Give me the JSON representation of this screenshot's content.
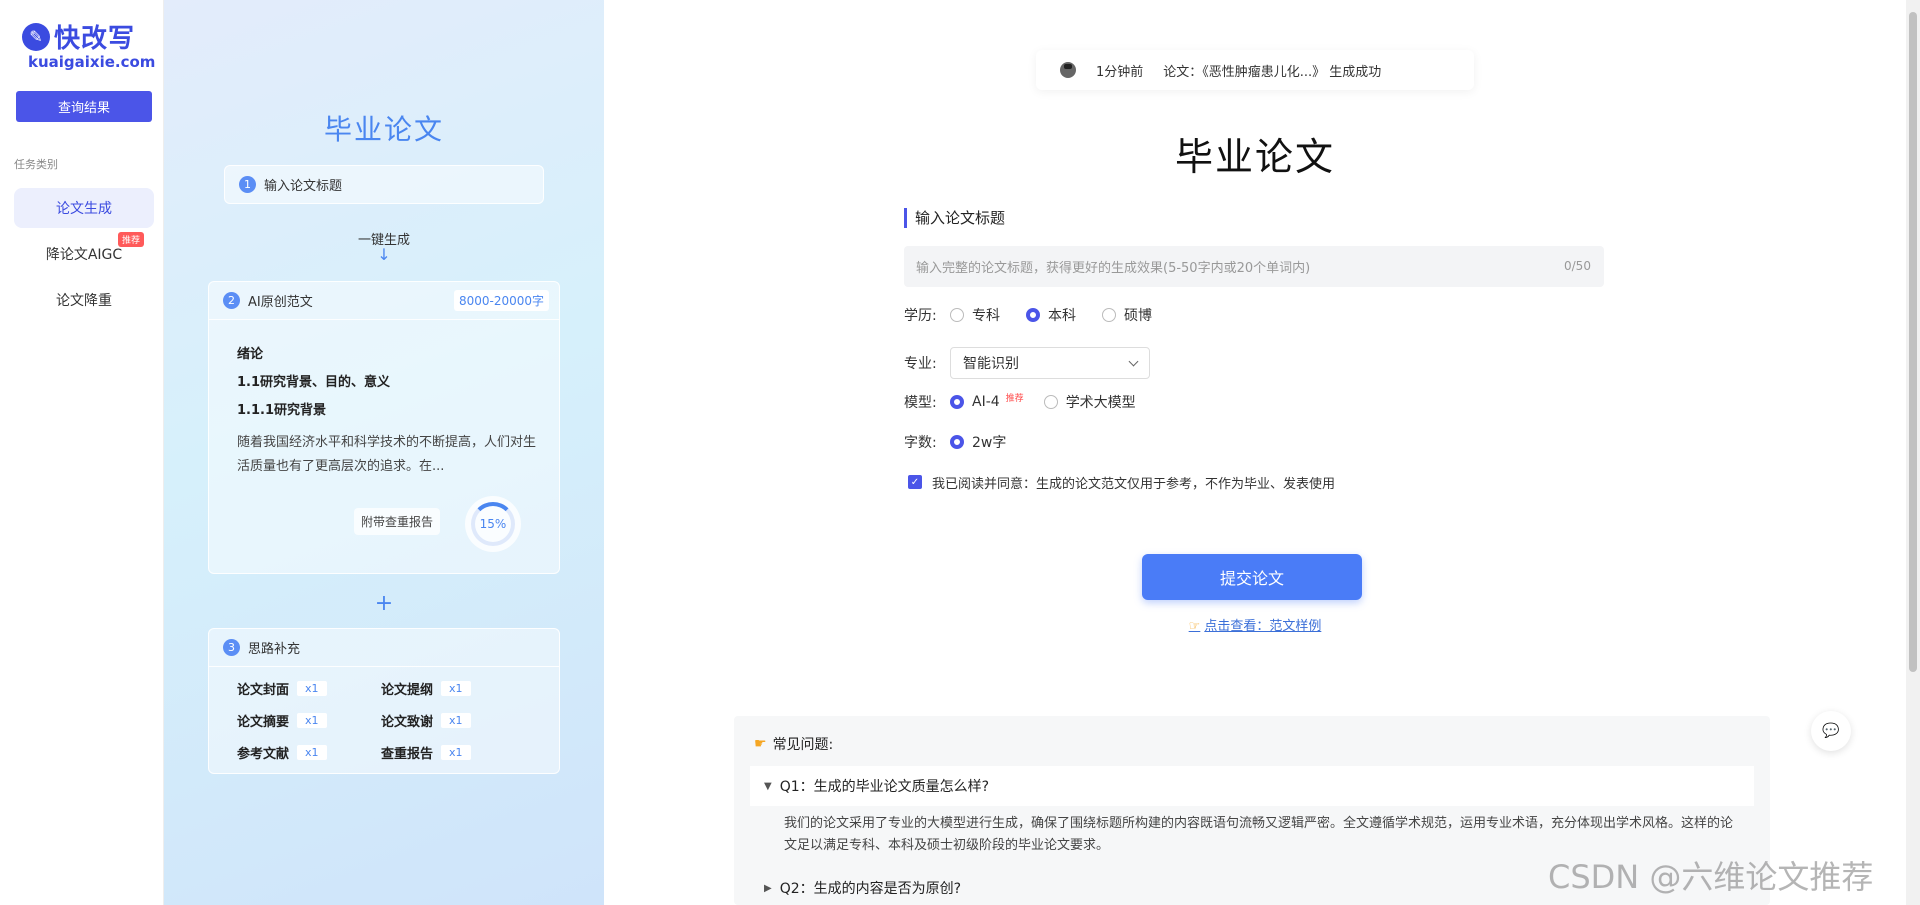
{
  "sidebar": {
    "logo_text": "快改写",
    "logo_sub": "kuaigaixie.com",
    "query_button": "查询结果",
    "task_label": "任务类别",
    "items": [
      {
        "label": "论文生成"
      },
      {
        "label": "降论文AIGC",
        "badge": "推荐"
      },
      {
        "label": "论文降重"
      }
    ]
  },
  "promo": {
    "title": "毕业论文",
    "step1": {
      "num": "1",
      "label": "输入论文标题"
    },
    "oneclick": "一键生成",
    "arrow": "↓",
    "step2": {
      "num": "2",
      "label": "AI原创范文",
      "word_badge": "8000-20000字",
      "lines": [
        "绪论",
        "1.1研究背景、目的、意义",
        "1.1.1研究背景"
      ],
      "paragraph": "随着我国经济水平和科学技术的不断提高，人们对生活质量也有了更高层次的追求。在...",
      "report_label": "附带查重报告",
      "report_percent": "15%"
    },
    "plus": "+",
    "step3": {
      "num": "3",
      "label": "思路补充",
      "items": [
        {
          "label": "论文封面",
          "count": "x1"
        },
        {
          "label": "论文提纲",
          "count": "x1"
        },
        {
          "label": "论文摘要",
          "count": "x1"
        },
        {
          "label": "论文致谢",
          "count": "x1"
        },
        {
          "label": "参考文献",
          "count": "x1"
        },
        {
          "label": "查重报告",
          "count": "x1"
        }
      ]
    }
  },
  "main": {
    "toast": {
      "time": "1分钟前",
      "message": "论文：《恶性肿瘤患儿化...》 生成成功"
    },
    "title": "毕业论文",
    "section_label": "输入论文标题",
    "title_input": {
      "placeholder": "输入完整的论文标题，获得更好的生成效果(5-50字内或20个单词内)",
      "counter": "0/50"
    },
    "education": {
      "label": "学历:",
      "options": [
        "专科",
        "本科",
        "硕博"
      ],
      "selected": "本科"
    },
    "major": {
      "label": "专业:",
      "value": "智能识别"
    },
    "model": {
      "label": "模型:",
      "options": [
        "AI-4",
        "学术大模型"
      ],
      "selected": "AI-4",
      "badge": "推荐"
    },
    "words": {
      "label": "字数:",
      "value": "2w字"
    },
    "agreement": "我已阅读并同意：生成的论文范文仅用于参考，不作为毕业、发表使用",
    "submit": "提交论文",
    "sample_link": "点击查看：范文样例",
    "faq": {
      "heading": "常见问题:",
      "q1": "Q1：生成的毕业论文质量怎么样?",
      "a1": "我们的论文采用了专业的大模型进行生成，确保了围绕标题所构建的内容既语句流畅又逻辑严密。全文遵循学术规范，运用专业术语，充分体现出学术风格。这样的论文足以满足专科、本科及硕士初级阶段的毕业论文要求。",
      "q2": "Q2：生成的内容是否为原创?"
    }
  },
  "watermark": "CSDN @六维论文推荐",
  "colors": {
    "accent": "#4b55e8",
    "promo_blue": "#4a86f0",
    "submit": "#4a7cf7"
  }
}
